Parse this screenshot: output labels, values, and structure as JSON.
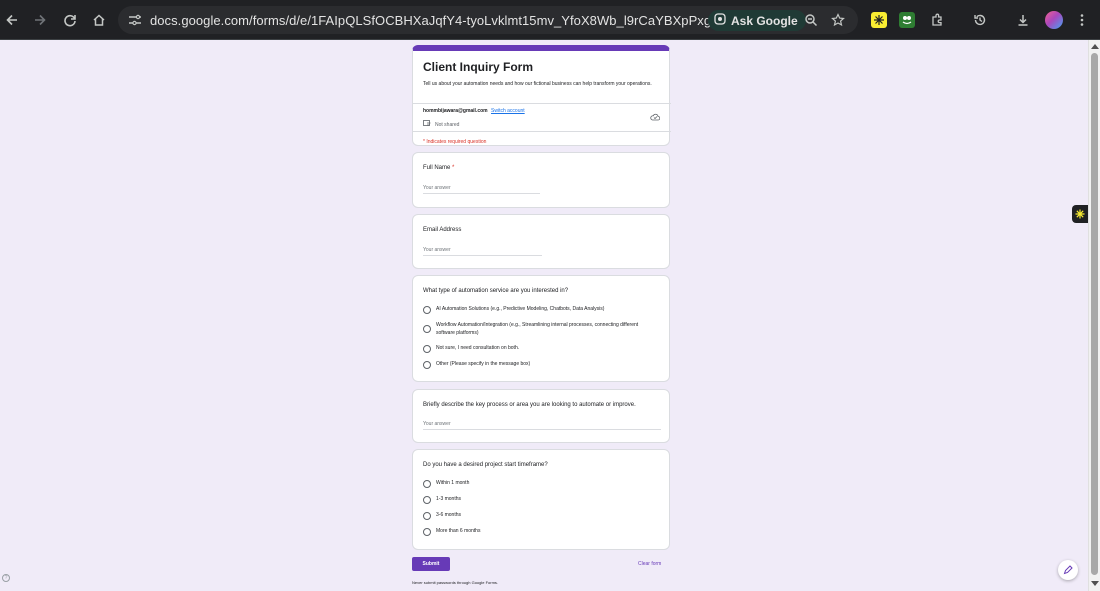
{
  "browser": {
    "url": "docs.google.com/forms/d/e/1FAIpQLSfOCBHXaJqfY4-tyoLvklmt15mv_YfoX8Wb_l9rCaYBXpPxgA/viewform",
    "ask_google_label": "Ask Google"
  },
  "form": {
    "title": "Client Inquiry Form",
    "description": "Tell us about your automation needs and how our fictional business can help transform your operations.",
    "account_email": "hommbijawara@gmail.com",
    "switch_account_label": "Switch account",
    "not_shared_label": "Not shared",
    "required_note": "* Indicates required question"
  },
  "questions": {
    "full_name": {
      "label": "Full Name",
      "required_mark": "*",
      "placeholder": "Your answer"
    },
    "email": {
      "label": "Email Address",
      "placeholder": "Your answer"
    },
    "service": {
      "label": "What type of automation service are you interested in?",
      "options": [
        "AI Automation Solutions (e.g., Predictive Modeling, Chatbots, Data Analysis)",
        "Workflow Automation/Integration (e.g., Streamlining internal processes, connecting different software platforms)",
        "Not sure, I need consultation on both.",
        "Other (Please specify in the message box)"
      ]
    },
    "process": {
      "label": "Briefly describe the key process or area you are looking to automate or improve.",
      "placeholder": "Your answer"
    },
    "timeframe": {
      "label": "Do you have a desired project start timeframe?",
      "options": [
        "Within 1 month",
        "1-3 months",
        "3-6 months",
        "More than 6 months"
      ]
    }
  },
  "footer": {
    "submit_label": "Submit",
    "clear_label": "Clear form",
    "password_note": "Never submit passwords through Google Forms."
  },
  "colors": {
    "accent": "#673ab7",
    "page_bg": "#f0ebf8",
    "required": "#d93025"
  },
  "icons": [
    "back-icon",
    "forward-icon",
    "reload-icon",
    "home-icon",
    "site-info-icon",
    "lens-icon",
    "zoom-icon",
    "star-icon",
    "extensions-icon",
    "history-icon",
    "download-icon",
    "menu-icon",
    "cloud-icon",
    "not-shared-icon",
    "help-icon",
    "edit-icon"
  ]
}
